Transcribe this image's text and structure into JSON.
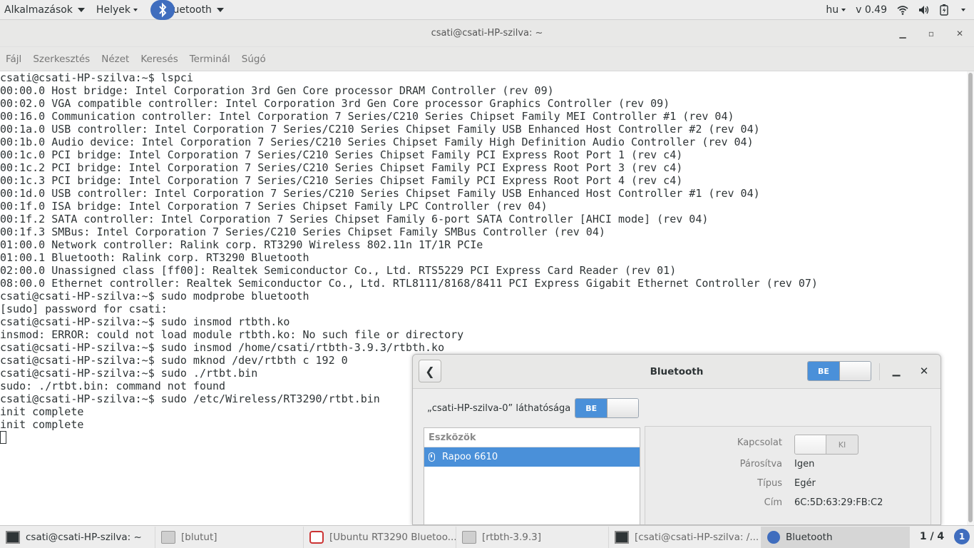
{
  "top_panel": {
    "apps_label": "Alkalmazások",
    "places_label": "Helyek",
    "active_app_label": "Bluetooth",
    "keyboard_layout": "hu",
    "volume_text": "v 0.49"
  },
  "terminal": {
    "title": "csati@csati-HP-szilva: ~",
    "menu": [
      "Fájl",
      "Szerkesztés",
      "Nézet",
      "Keresés",
      "Terminál",
      "Súgó"
    ],
    "lines": [
      "csati@csati-HP-szilva:~$ lspci",
      "00:00.0 Host bridge: Intel Corporation 3rd Gen Core processor DRAM Controller (rev 09)",
      "00:02.0 VGA compatible controller: Intel Corporation 3rd Gen Core processor Graphics Controller (rev 09)",
      "00:16.0 Communication controller: Intel Corporation 7 Series/C210 Series Chipset Family MEI Controller #1 (rev 04)",
      "00:1a.0 USB controller: Intel Corporation 7 Series/C210 Series Chipset Family USB Enhanced Host Controller #2 (rev 04)",
      "00:1b.0 Audio device: Intel Corporation 7 Series/C210 Series Chipset Family High Definition Audio Controller (rev 04)",
      "00:1c.0 PCI bridge: Intel Corporation 7 Series/C210 Series Chipset Family PCI Express Root Port 1 (rev c4)",
      "00:1c.2 PCI bridge: Intel Corporation 7 Series/C210 Series Chipset Family PCI Express Root Port 3 (rev c4)",
      "00:1c.3 PCI bridge: Intel Corporation 7 Series/C210 Series Chipset Family PCI Express Root Port 4 (rev c4)",
      "00:1d.0 USB controller: Intel Corporation 7 Series/C210 Series Chipset Family USB Enhanced Host Controller #1 (rev 04)",
      "00:1f.0 ISA bridge: Intel Corporation 7 Series Chipset Family LPC Controller (rev 04)",
      "00:1f.2 SATA controller: Intel Corporation 7 Series Chipset Family 6-port SATA Controller [AHCI mode] (rev 04)",
      "00:1f.3 SMBus: Intel Corporation 7 Series/C210 Series Chipset Family SMBus Controller (rev 04)",
      "01:00.0 Network controller: Ralink corp. RT3290 Wireless 802.11n 1T/1R PCIe",
      "01:00.1 Bluetooth: Ralink corp. RT3290 Bluetooth",
      "02:00.0 Unassigned class [ff00]: Realtek Semiconductor Co., Ltd. RTS5229 PCI Express Card Reader (rev 01)",
      "08:00.0 Ethernet controller: Realtek Semiconductor Co., Ltd. RTL8111/8168/8411 PCI Express Gigabit Ethernet Controller (rev 07)",
      "csati@csati-HP-szilva:~$ sudo modprobe bluetooth",
      "[sudo] password for csati:",
      "csati@csati-HP-szilva:~$ sudo insmod rtbth.ko",
      "insmod: ERROR: could not load module rtbth.ko: No such file or directory",
      "csati@csati-HP-szilva:~$ sudo insmod /home/csati/rtbth-3.9.3/rtbth.ko",
      "csati@csati-HP-szilva:~$ sudo mknod /dev/rtbth c 192 0",
      "csati@csati-HP-szilva:~$ sudo ./rtbt.bin",
      "sudo: ./rtbt.bin: command not found",
      "csati@csati-HP-szilva:~$ sudo /etc/Wireless/RT3290/rtbt.bin",
      "init complete",
      "init complete"
    ]
  },
  "bluetooth": {
    "title": "Bluetooth",
    "power_label": "BE",
    "visibility_label": "„csati-HP-szilva-0” láthatósága",
    "visibility_switch": "BE",
    "devices_header": "Eszközök",
    "devices": [
      {
        "name": "Rapoo 6610",
        "icon": "mouse-icon"
      }
    ],
    "details": {
      "connection_label": "Kapcsolat",
      "connection_switch": "KI",
      "paired_label": "Párosítva",
      "paired_value": "Igen",
      "type_label": "Típus",
      "type_value": "Egér",
      "address_label": "Cím",
      "address_value": "6C:5D:63:29:FB:C2"
    }
  },
  "taskbar": {
    "tasks": [
      {
        "label": "csati@csati-HP-szilva: ~",
        "icon": "terminal-icon"
      },
      {
        "label": "[blutut]",
        "icon": "folder-icon"
      },
      {
        "label": "[Ubuntu RT3290 Bluetoo...",
        "icon": "browser-icon"
      },
      {
        "label": "[rtbth-3.9.3]",
        "icon": "folder-icon"
      },
      {
        "label": "[csati@csati-HP-szilva: /...",
        "icon": "terminal-icon"
      },
      {
        "label": "Bluetooth",
        "icon": "bluetooth-icon"
      }
    ],
    "workspace": "1 / 4",
    "notifications": "1"
  }
}
